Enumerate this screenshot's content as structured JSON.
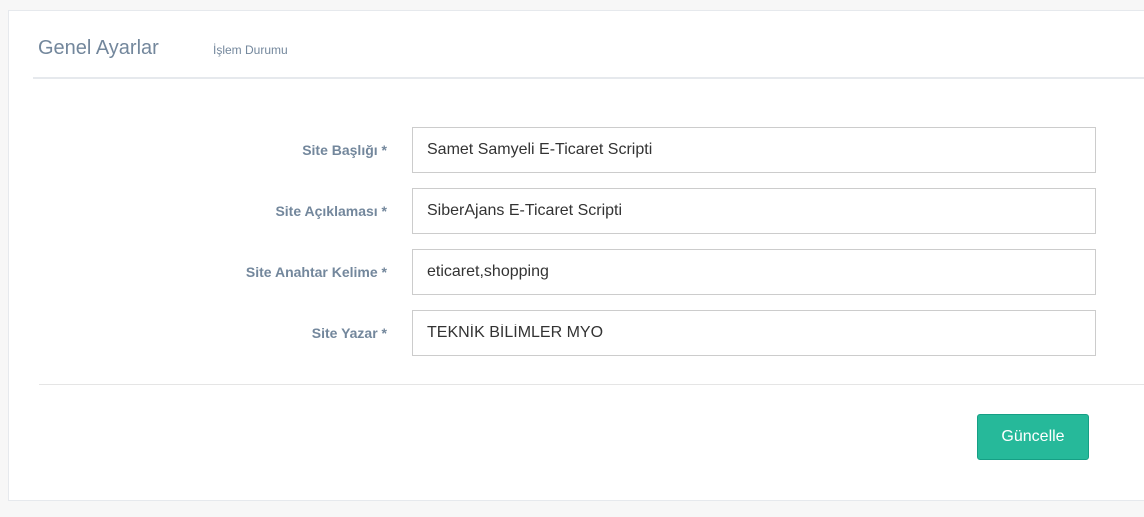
{
  "header": {
    "title": "Genel Ayarlar",
    "subtitle": "İşlem Durumu"
  },
  "form": {
    "fields": [
      {
        "label": "Site Başlığı *",
        "value": "Samet Samyeli E-Ticaret Scripti"
      },
      {
        "label": "Site Açıklaması *",
        "value": "SiberAjans E-Ticaret Scripti"
      },
      {
        "label": "Site Anahtar Kelime *",
        "value": "eticaret,shopping"
      },
      {
        "label": "Site Yazar *",
        "value": "TEKNİK BİLİMLER MYO"
      }
    ],
    "submit_label": "Güncelle"
  },
  "colors": {
    "accent": "#26b99a",
    "label_text": "#73879c"
  }
}
